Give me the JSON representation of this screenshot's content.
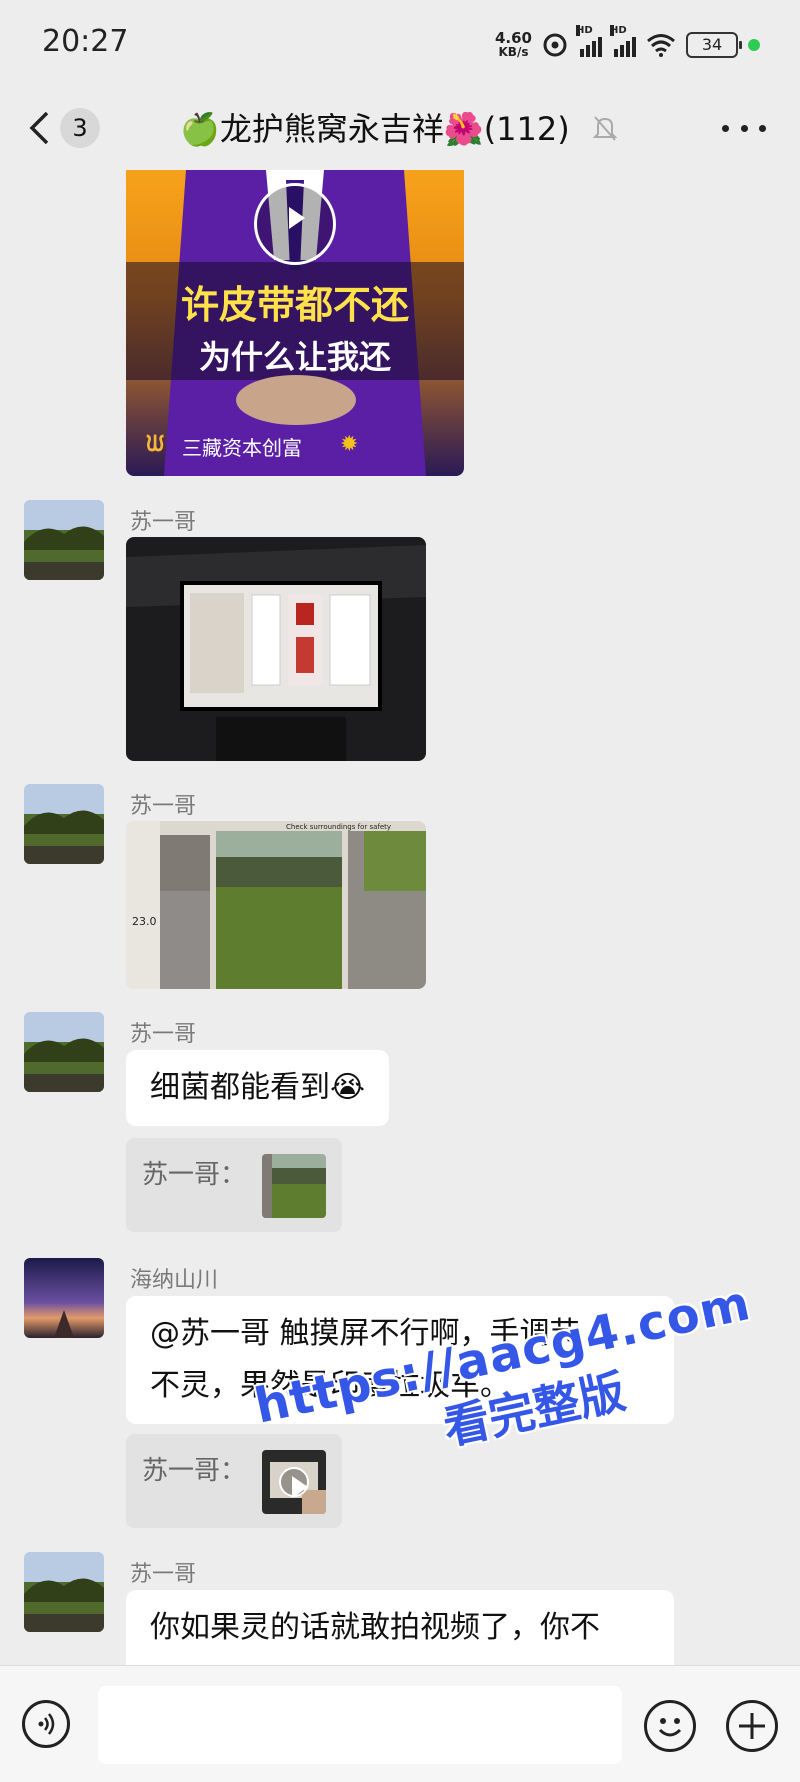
{
  "status_bar": {
    "time": "20:27",
    "net_speed_value": "4.60",
    "net_speed_unit": "KB/s",
    "signal_1_label": "HD",
    "signal_2_label": "HD",
    "battery": "34"
  },
  "header": {
    "unread_count": "3",
    "title": "🍏龙护熊窝永吉祥🌺(112)"
  },
  "messages": {
    "video1": {
      "headline": "许皮带都不还",
      "subline": "为什么让我还",
      "brand": "三藏资本创富"
    },
    "m1": {
      "sender": "苏一哥"
    },
    "m2": {
      "sender": "苏一哥",
      "overlay_text": "Check surroundings for safety",
      "overlay_num": "23.0"
    },
    "m3": {
      "sender": "苏一哥",
      "text": "细菌都能看到😭",
      "quote_label": "苏一哥："
    },
    "m4": {
      "sender": "海纳山川",
      "line1": "@苏一哥  触摸屏不行啊，手调节",
      "line2": "不灵，果然是印度垃圾车。",
      "quote_label": "苏一哥："
    },
    "m5": {
      "sender": "苏一哥",
      "text": "你如果灵的话就敢拍视频了，你不"
    }
  },
  "input": {
    "placeholder": ""
  },
  "watermark": {
    "url": "https://aacg4.com",
    "text": "看完整版"
  },
  "colors": {
    "background": "#ededed",
    "bubble": "#ffffff",
    "quote": "#e2e2e2",
    "watermark": "#3557e8",
    "online_dot": "#2ecc52"
  },
  "icons": [
    "back-chevron-icon",
    "mute-bell-icon",
    "more-dots-icon",
    "voice-icon",
    "emoji-icon",
    "plus-icon",
    "play-icon",
    "wifi-icon",
    "signal-icon",
    "battery-icon"
  ]
}
